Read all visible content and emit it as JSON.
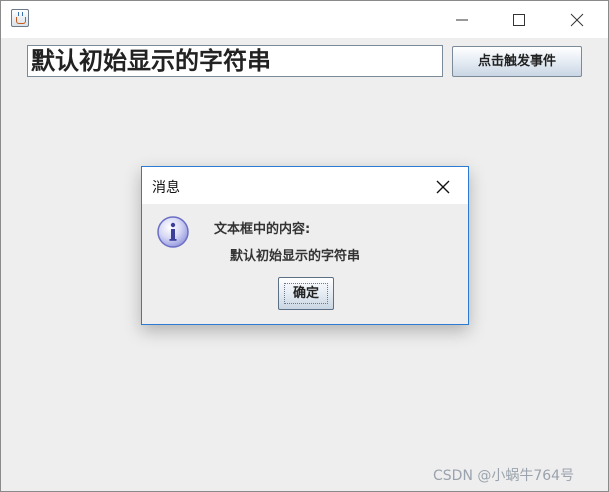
{
  "main": {
    "text_field_value": "默认初始显示的字符串",
    "trigger_button_label": "点击触发事件"
  },
  "dialog": {
    "title": "消息",
    "message_line1": "文本框中的内容:",
    "message_line2": "默认初始显示的字符串",
    "ok_label": "确定"
  },
  "icons": {
    "app": "java-cup-icon",
    "minimize": "minimize-icon",
    "maximize": "maximize-icon",
    "close": "close-icon",
    "info": "info-icon"
  },
  "watermark": "CSDN @小蜗牛764号",
  "colors": {
    "dialog_border": "#2b7bd0",
    "window_background": "#eeeeee",
    "titlebar_background": "#ffffff"
  }
}
